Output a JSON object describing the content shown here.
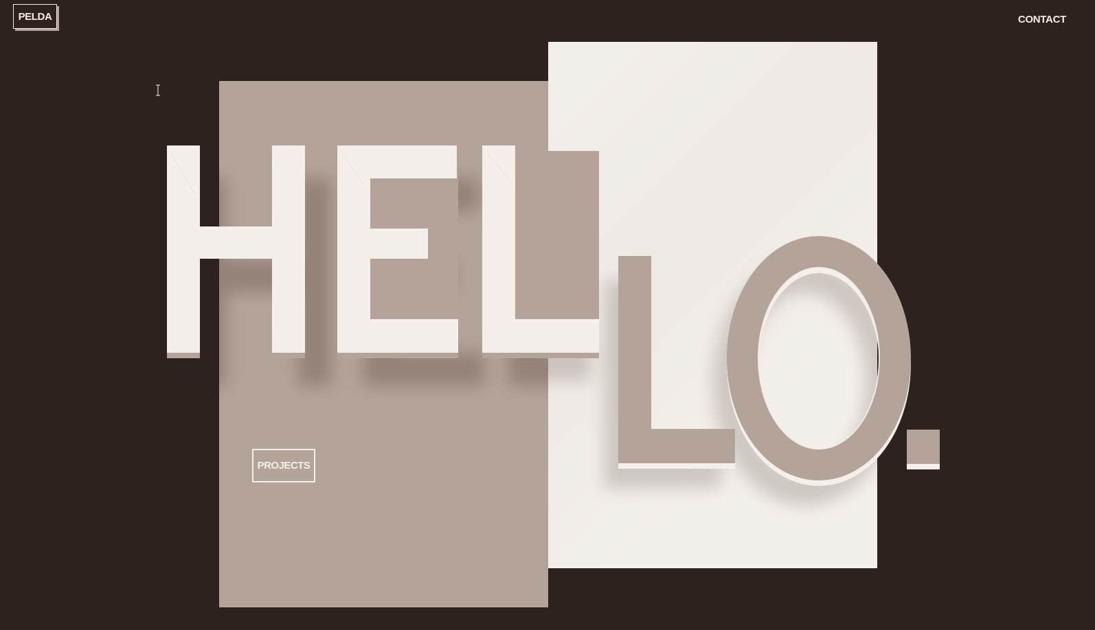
{
  "header": {
    "logo_label": "PELDA",
    "contact_label": "CONTACT"
  },
  "hero": {
    "headline": "HELLO.",
    "projects_label": "PROJECTS"
  },
  "colors": {
    "background": "#2e221f",
    "tan": "#b4a398",
    "light": "#f3efeb",
    "text_light": "#f4efeb"
  },
  "icons": {
    "cursor": "text-cursor-icon"
  }
}
